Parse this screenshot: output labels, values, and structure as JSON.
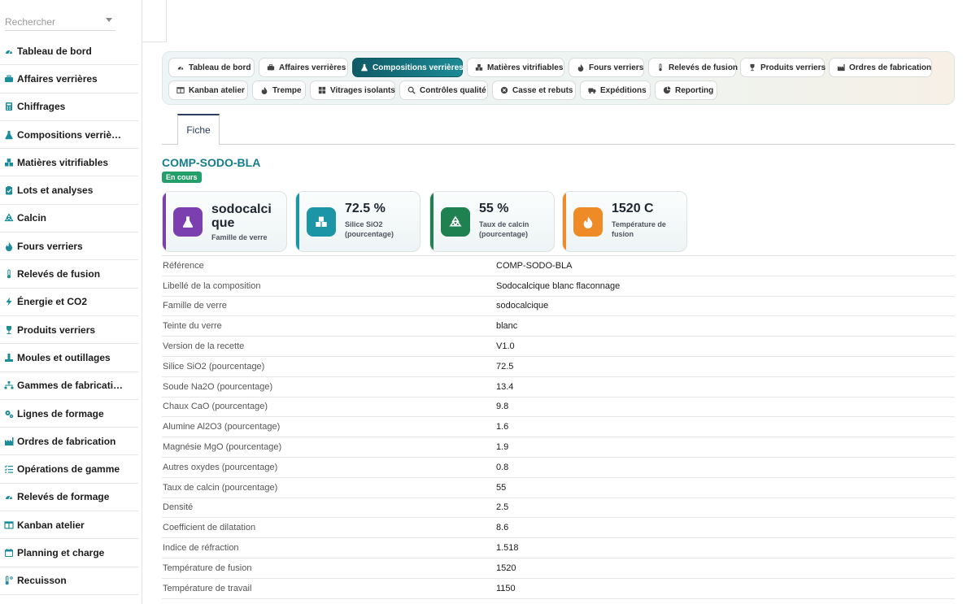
{
  "search": {
    "placeholder": "Rechercher"
  },
  "sidebar": {
    "items": [
      {
        "label": "Tableau de bord",
        "icon": "gauge-icon"
      },
      {
        "label": "Affaires verrières",
        "icon": "briefcase-icon"
      },
      {
        "label": "Chiffrages",
        "icon": "calculator-icon"
      },
      {
        "label": "Compositions verriè…",
        "icon": "flask-icon"
      },
      {
        "label": "Matières vitrifiables",
        "icon": "cubes-icon"
      },
      {
        "label": "Lots et analyses",
        "icon": "clipboard-check-icon"
      },
      {
        "label": "Calcin",
        "icon": "recycle-icon"
      },
      {
        "label": "Fours verriers",
        "icon": "fire-icon"
      },
      {
        "label": "Relevés de fusion",
        "icon": "thermometer-icon"
      },
      {
        "label": "Énergie et CO2",
        "icon": "bolt-icon"
      },
      {
        "label": "Produits verriers",
        "icon": "wine-glass-icon"
      },
      {
        "label": "Moules et outillages",
        "icon": "tools-icon"
      },
      {
        "label": "Gammes de fabricati…",
        "icon": "sitemap-icon"
      },
      {
        "label": "Lignes de formage",
        "icon": "cogs-icon"
      },
      {
        "label": "Ordres de fabrication",
        "icon": "industry-icon"
      },
      {
        "label": "Opérations de gamme",
        "icon": "list-check-icon"
      },
      {
        "label": "Relevés de formage",
        "icon": "gauge-icon"
      },
      {
        "label": "Kanban atelier",
        "icon": "columns-icon"
      },
      {
        "label": "Planning et charge",
        "icon": "calendar-icon"
      },
      {
        "label": "Recuisson",
        "icon": "temperature-icon"
      }
    ]
  },
  "tabs": [
    {
      "label": "Tableau de bord",
      "icon": "gauge-icon",
      "active": false
    },
    {
      "label": "Affaires verrières",
      "icon": "briefcase-icon",
      "active": false
    },
    {
      "label": "Compositions verrières",
      "icon": "flask-icon",
      "active": true
    },
    {
      "label": "Matières vitrifiables",
      "icon": "cubes-icon",
      "active": false
    },
    {
      "label": "Fours verriers",
      "icon": "fire-icon",
      "active": false
    },
    {
      "label": "Relevés de fusion",
      "icon": "thermometer-icon",
      "active": false
    },
    {
      "label": "Produits verriers",
      "icon": "wine-glass-icon",
      "active": false
    },
    {
      "label": "Ordres de fabrication",
      "icon": "industry-icon",
      "active": false
    },
    {
      "label": "Kanban atelier",
      "icon": "columns-icon",
      "active": false
    },
    {
      "label": "Trempe",
      "icon": "fire-icon",
      "active": false
    },
    {
      "label": "Vitrages isolants",
      "icon": "grid-icon",
      "active": false
    },
    {
      "label": "Contrôles qualité",
      "icon": "search-icon",
      "active": false
    },
    {
      "label": "Casse et rebuts",
      "icon": "times-circle-icon",
      "active": false
    },
    {
      "label": "Expéditions",
      "icon": "truck-icon",
      "active": false
    },
    {
      "label": "Reporting",
      "icon": "pie-chart-icon",
      "active": false
    }
  ],
  "subtab": {
    "label": "Fiche"
  },
  "record": {
    "title": "COMP-SODO-BLA",
    "status": "En cours"
  },
  "colors": {
    "accent": "#167c8a",
    "status": "#23a06a"
  },
  "kpis": [
    {
      "value": "sodocalcique",
      "label": "Famille de verre",
      "icon": "flask-icon",
      "color": "#7b3fb0"
    },
    {
      "value": "72.5 %",
      "label": "Silice SiO2 (pourcentage)",
      "icon": "cubes-icon",
      "color": "#1c96a6"
    },
    {
      "value": "55 %",
      "label": "Taux de calcin (pourcentage)",
      "icon": "recycle-icon",
      "color": "#1f8050"
    },
    {
      "value": "1520 C",
      "label": "Température de fusion",
      "icon": "fire-icon",
      "color": "#ef8b27"
    }
  ],
  "fields": [
    {
      "key": "Référence",
      "value": "COMP-SODO-BLA"
    },
    {
      "key": "Libellé de la composition",
      "value": "Sodocalcique blanc flaconnage"
    },
    {
      "key": "Famille de verre",
      "value": "sodocalcique"
    },
    {
      "key": "Teinte du verre",
      "value": "blanc"
    },
    {
      "key": "Version de la recette",
      "value": "V1.0"
    },
    {
      "key": "Silice SiO2 (pourcentage)",
      "value": "72.5"
    },
    {
      "key": "Soude Na2O (pourcentage)",
      "value": "13.4"
    },
    {
      "key": "Chaux CaO (pourcentage)",
      "value": "9.8"
    },
    {
      "key": "Alumine Al2O3 (pourcentage)",
      "value": "1.6"
    },
    {
      "key": "Magnésie MgO (pourcentage)",
      "value": "1.9"
    },
    {
      "key": "Autres oxydes (pourcentage)",
      "value": "0.8"
    },
    {
      "key": "Taux de calcin (pourcentage)",
      "value": "55"
    },
    {
      "key": "Densité",
      "value": "2.5"
    },
    {
      "key": "Coefficient de dilatation",
      "value": "8.6"
    },
    {
      "key": "Indice de réfraction",
      "value": "1.518"
    },
    {
      "key": "Température de fusion",
      "value": "1520"
    },
    {
      "key": "Température de travail",
      "value": "1150"
    }
  ]
}
